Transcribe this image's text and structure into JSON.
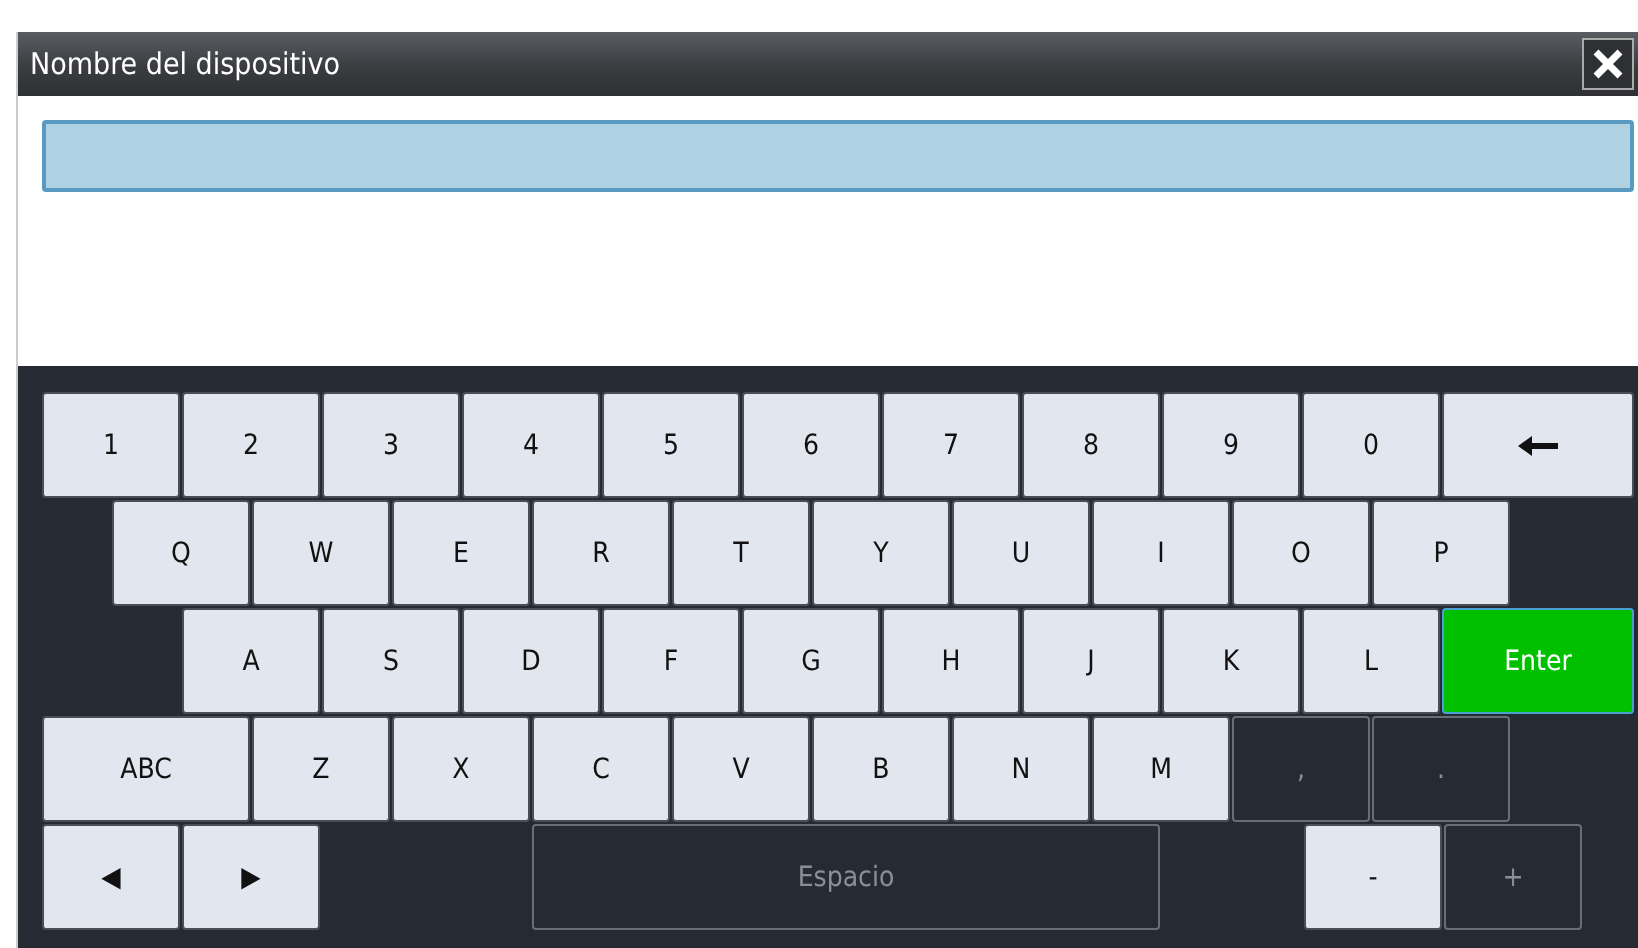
{
  "window": {
    "title": "Nombre del dispositivo"
  },
  "keyboard": {
    "rows": [
      {
        "keys": [
          {
            "kind": "char",
            "label": "1",
            "disabled": false
          },
          {
            "kind": "char",
            "label": "2",
            "disabled": false
          },
          {
            "kind": "char",
            "label": "3",
            "disabled": false
          },
          {
            "kind": "char",
            "label": "4",
            "disabled": false
          },
          {
            "kind": "char",
            "label": "5",
            "disabled": false
          },
          {
            "kind": "char",
            "label": "6",
            "disabled": false
          },
          {
            "kind": "char",
            "label": "7",
            "disabled": false
          },
          {
            "kind": "char",
            "label": "8",
            "disabled": false
          },
          {
            "kind": "char",
            "label": "9",
            "disabled": false
          },
          {
            "kind": "char",
            "label": "0",
            "disabled": false
          },
          {
            "kind": "backspace",
            "disabled": false
          }
        ]
      },
      {
        "keys": [
          {
            "kind": "char",
            "label": "Q",
            "disabled": false
          },
          {
            "kind": "char",
            "label": "W",
            "disabled": false
          },
          {
            "kind": "char",
            "label": "E",
            "disabled": false
          },
          {
            "kind": "char",
            "label": "R",
            "disabled": false
          },
          {
            "kind": "char",
            "label": "T",
            "disabled": false
          },
          {
            "kind": "char",
            "label": "Y",
            "disabled": false
          },
          {
            "kind": "char",
            "label": "U",
            "disabled": false
          },
          {
            "kind": "char",
            "label": "I",
            "disabled": false
          },
          {
            "kind": "char",
            "label": "O",
            "disabled": false
          },
          {
            "kind": "char",
            "label": "P",
            "disabled": false
          }
        ]
      },
      {
        "keys": [
          {
            "kind": "char",
            "label": "A",
            "disabled": false
          },
          {
            "kind": "char",
            "label": "S",
            "disabled": false
          },
          {
            "kind": "char",
            "label": "D",
            "disabled": false
          },
          {
            "kind": "char",
            "label": "F",
            "disabled": false
          },
          {
            "kind": "char",
            "label": "G",
            "disabled": false
          },
          {
            "kind": "char",
            "label": "H",
            "disabled": false
          },
          {
            "kind": "char",
            "label": "J",
            "disabled": false
          },
          {
            "kind": "char",
            "label": "K",
            "disabled": false
          },
          {
            "kind": "char",
            "label": "L",
            "disabled": false
          },
          {
            "kind": "enter",
            "label": "Enter",
            "disabled": false
          }
        ]
      },
      {
        "keys": [
          {
            "kind": "wide",
            "label": "ABC",
            "disabled": false
          },
          {
            "kind": "char",
            "label": "Z",
            "disabled": false
          },
          {
            "kind": "char",
            "label": "X",
            "disabled": false
          },
          {
            "kind": "char",
            "label": "C",
            "disabled": false
          },
          {
            "kind": "char",
            "label": "V",
            "disabled": false
          },
          {
            "kind": "char",
            "label": "B",
            "disabled": false
          },
          {
            "kind": "char",
            "label": "N",
            "disabled": false
          },
          {
            "kind": "char",
            "label": "M",
            "disabled": false
          },
          {
            "kind": "char",
            "label": ",",
            "disabled": true
          },
          {
            "kind": "char",
            "label": ".",
            "disabled": true
          }
        ]
      },
      {
        "keys": [
          {
            "kind": "char",
            "label": "◀",
            "disabled": false
          },
          {
            "kind": "char",
            "label": "▶",
            "disabled": false
          },
          {
            "kind": "space",
            "label": "Espacio",
            "disabled": true
          },
          {
            "kind": "char",
            "label": "-",
            "disabled": false
          },
          {
            "kind": "char",
            "label": "+",
            "disabled": true
          }
        ]
      }
    ]
  }
}
